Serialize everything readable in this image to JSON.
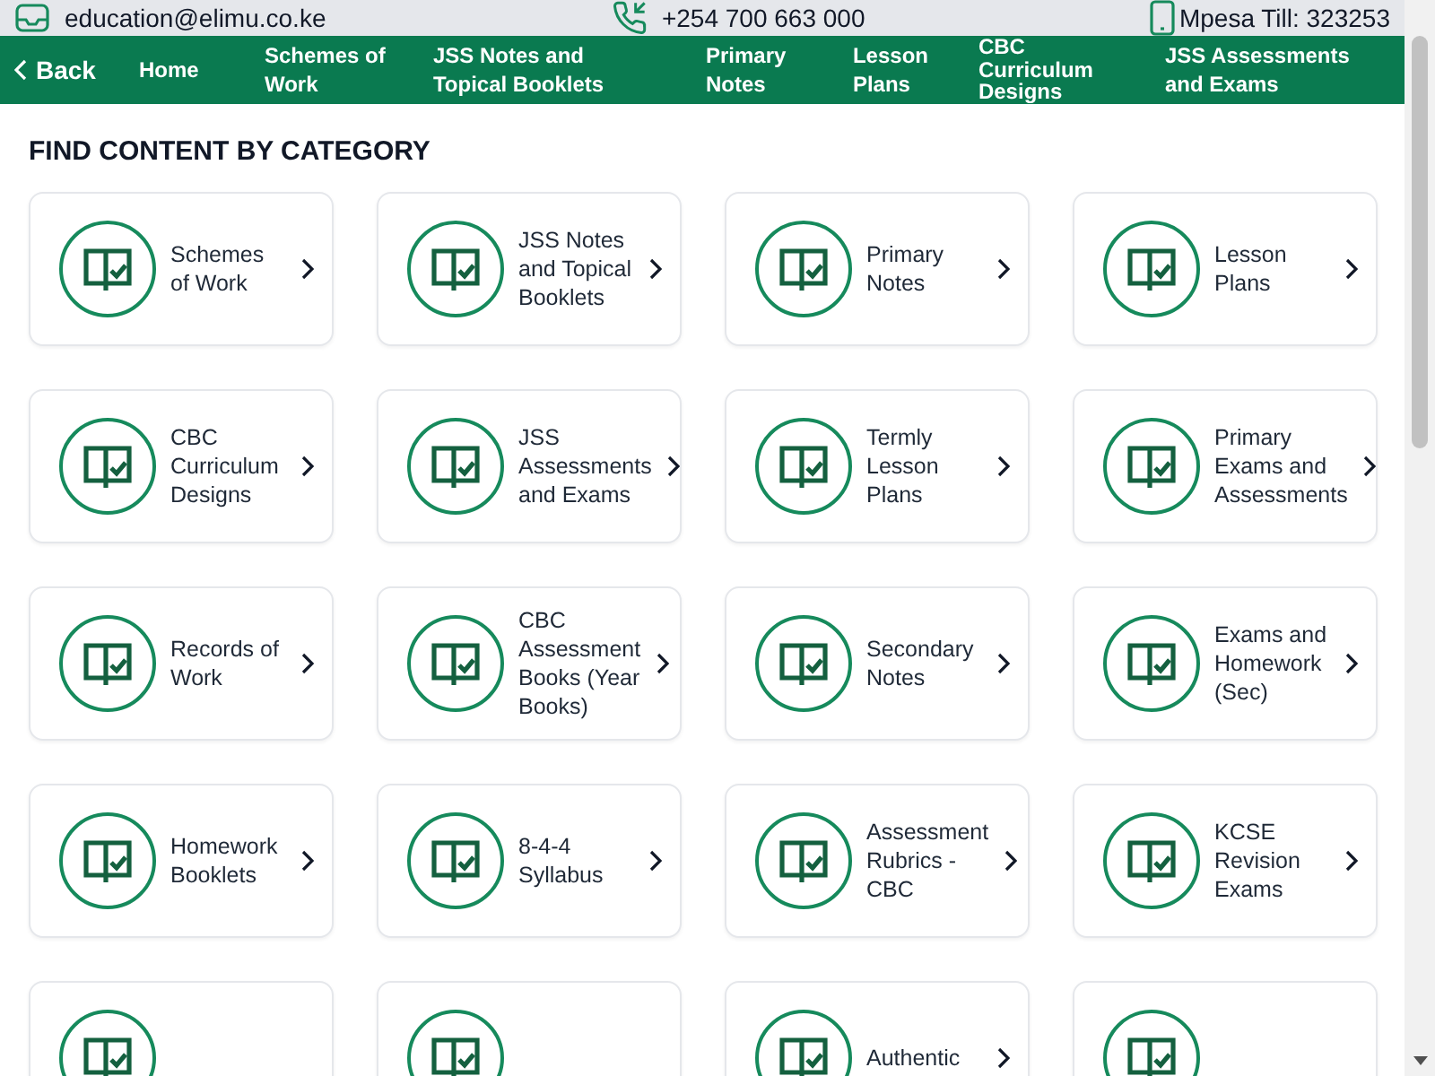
{
  "contact_bar": {
    "email": "education@elimu.co.ke",
    "phone": "+254 700 663 000",
    "till": "Mpesa Till: 323253"
  },
  "nav": {
    "back": "Back",
    "items": [
      "Home",
      "Schemes of Work",
      "JSS Notes and Topical Booklets",
      "Primary Notes",
      "Lesson Plans",
      "CBC Curriculum Designs",
      "JSS Assessments and Exams"
    ]
  },
  "section_title": "FIND CONTENT BY CATEGORY",
  "categories": [
    {
      "label": "Schemes of Work"
    },
    {
      "label": "JSS Notes and Topical Booklets"
    },
    {
      "label": "Primary Notes"
    },
    {
      "label": "Lesson Plans"
    },
    {
      "label": "CBC Curriculum Designs"
    },
    {
      "label": "JSS Assessments and Exams"
    },
    {
      "label": "Termly Lesson Plans"
    },
    {
      "label": "Primary Exams and Assessments"
    },
    {
      "label": "Records of Work"
    },
    {
      "label": "CBC Assessment Books (Year Books)"
    },
    {
      "label": "Secondary Notes"
    },
    {
      "label": "Exams and Homework (Sec)"
    },
    {
      "label": "Homework Booklets"
    },
    {
      "label": "8-4-4 Syllabus"
    },
    {
      "label": "Assessment Rubrics - CBC"
    },
    {
      "label": "KCSE Revision Exams"
    },
    {
      "kind": "untitled"
    },
    {
      "kind": "untitled"
    },
    {
      "label": "Authentic"
    },
    {
      "kind": "untitled"
    }
  ]
}
